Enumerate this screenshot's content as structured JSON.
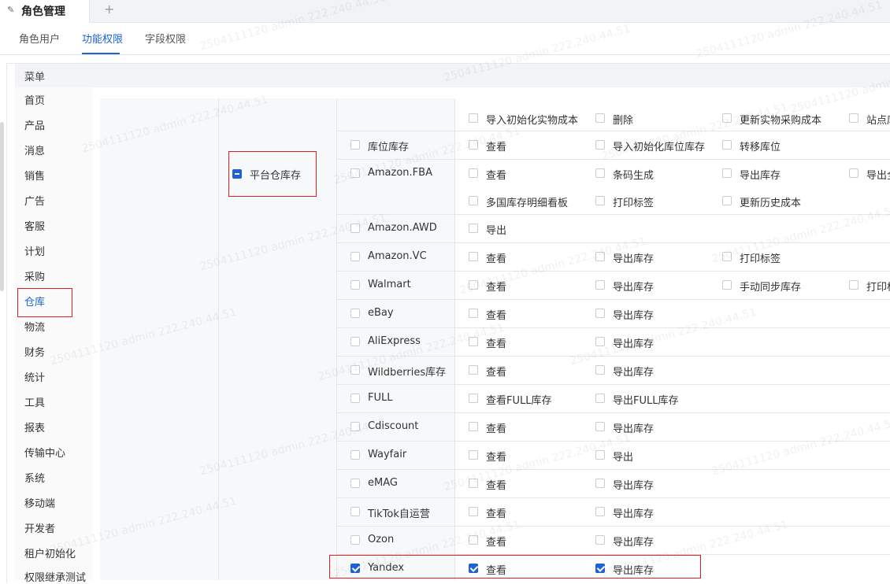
{
  "tab": {
    "title": "角色管理",
    "add": "+"
  },
  "subtabs": [
    "角色用户",
    "功能权限",
    "字段权限"
  ],
  "menu_header": "菜单",
  "sidebar": [
    "首页",
    "产品",
    "消息",
    "销售",
    "广告",
    "客服",
    "计划",
    "采购",
    "仓库",
    "物流",
    "财务",
    "统计",
    "工具",
    "报表",
    "传输中心",
    "系统",
    "移动端",
    "开发者",
    "租户初始化",
    "权限继承测试"
  ],
  "module": {
    "label": "平台仓库存",
    "state": "partial"
  },
  "rows": [
    {
      "name": "",
      "perms": [
        {
          "label": "导入初始化实物成本",
          "checked": false
        },
        {
          "label": "删除",
          "checked": false
        },
        {
          "label": "更新实物采购成本",
          "checked": false
        },
        {
          "label": "站点库",
          "checked": false
        }
      ]
    },
    {
      "name": "库位库存",
      "checked": false,
      "perms": [
        {
          "label": "查看",
          "checked": false
        },
        {
          "label": "导入初始化库位库存",
          "checked": false
        },
        {
          "label": "转移库位",
          "checked": false
        }
      ]
    },
    {
      "name": "Amazon.FBA",
      "checked": false,
      "perms": [
        {
          "label": "查看",
          "checked": false
        },
        {
          "label": "条码生成",
          "checked": false
        },
        {
          "label": "导出库存",
          "checked": false
        },
        {
          "label": "导出全",
          "checked": false
        },
        {
          "label": "多国库存明细看板",
          "checked": false
        },
        {
          "label": "打印标签",
          "checked": false
        },
        {
          "label": "更新历史成本",
          "checked": false
        }
      ]
    },
    {
      "name": "Amazon.AWD",
      "checked": false,
      "perms": [
        {
          "label": "导出",
          "checked": false
        }
      ]
    },
    {
      "name": "Amazon.VC",
      "checked": false,
      "perms": [
        {
          "label": "查看",
          "checked": false
        },
        {
          "label": "导出库存",
          "checked": false
        },
        {
          "label": "打印标签",
          "checked": false
        }
      ]
    },
    {
      "name": "Walmart",
      "checked": false,
      "perms": [
        {
          "label": "查看",
          "checked": false
        },
        {
          "label": "导出库存",
          "checked": false
        },
        {
          "label": "手动同步库存",
          "checked": false
        },
        {
          "label": "打印标",
          "checked": false
        }
      ]
    },
    {
      "name": "eBay",
      "checked": false,
      "perms": [
        {
          "label": "查看",
          "checked": false
        },
        {
          "label": "导出库存",
          "checked": false
        }
      ]
    },
    {
      "name": "AliExpress",
      "checked": false,
      "perms": [
        {
          "label": "查看",
          "checked": false
        },
        {
          "label": "导出库存",
          "checked": false
        }
      ]
    },
    {
      "name": "Wildberries库存",
      "checked": false,
      "perms": [
        {
          "label": "查看",
          "checked": false
        },
        {
          "label": "导出库存",
          "checked": false
        }
      ]
    },
    {
      "name": "FULL",
      "checked": false,
      "perms": [
        {
          "label": "查看FULL库存",
          "checked": false
        },
        {
          "label": "导出FULL库存",
          "checked": false
        }
      ]
    },
    {
      "name": "Cdiscount",
      "checked": false,
      "perms": [
        {
          "label": "查看",
          "checked": false
        },
        {
          "label": "导出库存",
          "checked": false
        }
      ]
    },
    {
      "name": "Wayfair",
      "checked": false,
      "perms": [
        {
          "label": "查看",
          "checked": false
        },
        {
          "label": "导出",
          "checked": false
        }
      ]
    },
    {
      "name": "eMAG",
      "checked": false,
      "perms": [
        {
          "label": "查看",
          "checked": false
        },
        {
          "label": "导出库存",
          "checked": false
        }
      ]
    },
    {
      "name": "TikTok自运营",
      "checked": false,
      "perms": [
        {
          "label": "查看",
          "checked": false
        },
        {
          "label": "导出库存",
          "checked": false
        }
      ]
    },
    {
      "name": "Ozon",
      "checked": false,
      "perms": [
        {
          "label": "查看",
          "checked": false
        },
        {
          "label": "导出库存",
          "checked": false
        }
      ]
    },
    {
      "name": "Yandex",
      "checked": true,
      "perms": [
        {
          "label": "查看",
          "checked": true
        },
        {
          "label": "导出库存",
          "checked": true
        }
      ]
    }
  ],
  "watermark": "2504111120 admin 222.240.44.51",
  "colors": {
    "accent": "#1e62d6",
    "highlight": "#e02020"
  }
}
